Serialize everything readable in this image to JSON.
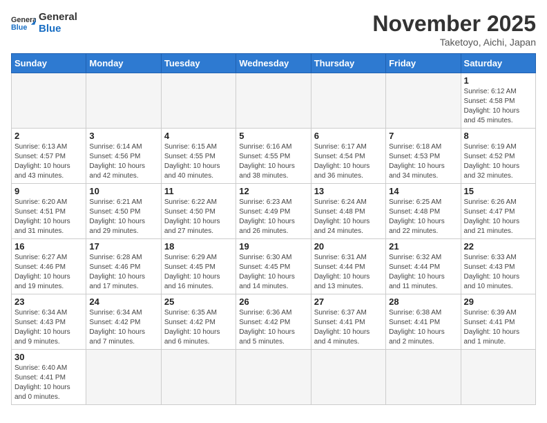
{
  "header": {
    "logo_general": "General",
    "logo_blue": "Blue",
    "month_year": "November 2025",
    "location": "Taketoyo, Aichi, Japan"
  },
  "days_of_week": [
    "Sunday",
    "Monday",
    "Tuesday",
    "Wednesday",
    "Thursday",
    "Friday",
    "Saturday"
  ],
  "weeks": [
    [
      {
        "day": "",
        "info": ""
      },
      {
        "day": "",
        "info": ""
      },
      {
        "day": "",
        "info": ""
      },
      {
        "day": "",
        "info": ""
      },
      {
        "day": "",
        "info": ""
      },
      {
        "day": "",
        "info": ""
      },
      {
        "day": "1",
        "info": "Sunrise: 6:12 AM\nSunset: 4:58 PM\nDaylight: 10 hours and 45 minutes."
      }
    ],
    [
      {
        "day": "2",
        "info": "Sunrise: 6:13 AM\nSunset: 4:57 PM\nDaylight: 10 hours and 43 minutes."
      },
      {
        "day": "3",
        "info": "Sunrise: 6:14 AM\nSunset: 4:56 PM\nDaylight: 10 hours and 42 minutes."
      },
      {
        "day": "4",
        "info": "Sunrise: 6:15 AM\nSunset: 4:55 PM\nDaylight: 10 hours and 40 minutes."
      },
      {
        "day": "5",
        "info": "Sunrise: 6:16 AM\nSunset: 4:55 PM\nDaylight: 10 hours and 38 minutes."
      },
      {
        "day": "6",
        "info": "Sunrise: 6:17 AM\nSunset: 4:54 PM\nDaylight: 10 hours and 36 minutes."
      },
      {
        "day": "7",
        "info": "Sunrise: 6:18 AM\nSunset: 4:53 PM\nDaylight: 10 hours and 34 minutes."
      },
      {
        "day": "8",
        "info": "Sunrise: 6:19 AM\nSunset: 4:52 PM\nDaylight: 10 hours and 32 minutes."
      }
    ],
    [
      {
        "day": "9",
        "info": "Sunrise: 6:20 AM\nSunset: 4:51 PM\nDaylight: 10 hours and 31 minutes."
      },
      {
        "day": "10",
        "info": "Sunrise: 6:21 AM\nSunset: 4:50 PM\nDaylight: 10 hours and 29 minutes."
      },
      {
        "day": "11",
        "info": "Sunrise: 6:22 AM\nSunset: 4:50 PM\nDaylight: 10 hours and 27 minutes."
      },
      {
        "day": "12",
        "info": "Sunrise: 6:23 AM\nSunset: 4:49 PM\nDaylight: 10 hours and 26 minutes."
      },
      {
        "day": "13",
        "info": "Sunrise: 6:24 AM\nSunset: 4:48 PM\nDaylight: 10 hours and 24 minutes."
      },
      {
        "day": "14",
        "info": "Sunrise: 6:25 AM\nSunset: 4:48 PM\nDaylight: 10 hours and 22 minutes."
      },
      {
        "day": "15",
        "info": "Sunrise: 6:26 AM\nSunset: 4:47 PM\nDaylight: 10 hours and 21 minutes."
      }
    ],
    [
      {
        "day": "16",
        "info": "Sunrise: 6:27 AM\nSunset: 4:46 PM\nDaylight: 10 hours and 19 minutes."
      },
      {
        "day": "17",
        "info": "Sunrise: 6:28 AM\nSunset: 4:46 PM\nDaylight: 10 hours and 17 minutes."
      },
      {
        "day": "18",
        "info": "Sunrise: 6:29 AM\nSunset: 4:45 PM\nDaylight: 10 hours and 16 minutes."
      },
      {
        "day": "19",
        "info": "Sunrise: 6:30 AM\nSunset: 4:45 PM\nDaylight: 10 hours and 14 minutes."
      },
      {
        "day": "20",
        "info": "Sunrise: 6:31 AM\nSunset: 4:44 PM\nDaylight: 10 hours and 13 minutes."
      },
      {
        "day": "21",
        "info": "Sunrise: 6:32 AM\nSunset: 4:44 PM\nDaylight: 10 hours and 11 minutes."
      },
      {
        "day": "22",
        "info": "Sunrise: 6:33 AM\nSunset: 4:43 PM\nDaylight: 10 hours and 10 minutes."
      }
    ],
    [
      {
        "day": "23",
        "info": "Sunrise: 6:34 AM\nSunset: 4:43 PM\nDaylight: 10 hours and 9 minutes."
      },
      {
        "day": "24",
        "info": "Sunrise: 6:34 AM\nSunset: 4:42 PM\nDaylight: 10 hours and 7 minutes."
      },
      {
        "day": "25",
        "info": "Sunrise: 6:35 AM\nSunset: 4:42 PM\nDaylight: 10 hours and 6 minutes."
      },
      {
        "day": "26",
        "info": "Sunrise: 6:36 AM\nSunset: 4:42 PM\nDaylight: 10 hours and 5 minutes."
      },
      {
        "day": "27",
        "info": "Sunrise: 6:37 AM\nSunset: 4:41 PM\nDaylight: 10 hours and 4 minutes."
      },
      {
        "day": "28",
        "info": "Sunrise: 6:38 AM\nSunset: 4:41 PM\nDaylight: 10 hours and 2 minutes."
      },
      {
        "day": "29",
        "info": "Sunrise: 6:39 AM\nSunset: 4:41 PM\nDaylight: 10 hours and 1 minute."
      }
    ],
    [
      {
        "day": "30",
        "info": "Sunrise: 6:40 AM\nSunset: 4:41 PM\nDaylight: 10 hours and 0 minutes."
      },
      {
        "day": "",
        "info": ""
      },
      {
        "day": "",
        "info": ""
      },
      {
        "day": "",
        "info": ""
      },
      {
        "day": "",
        "info": ""
      },
      {
        "day": "",
        "info": ""
      },
      {
        "day": "",
        "info": ""
      }
    ]
  ]
}
